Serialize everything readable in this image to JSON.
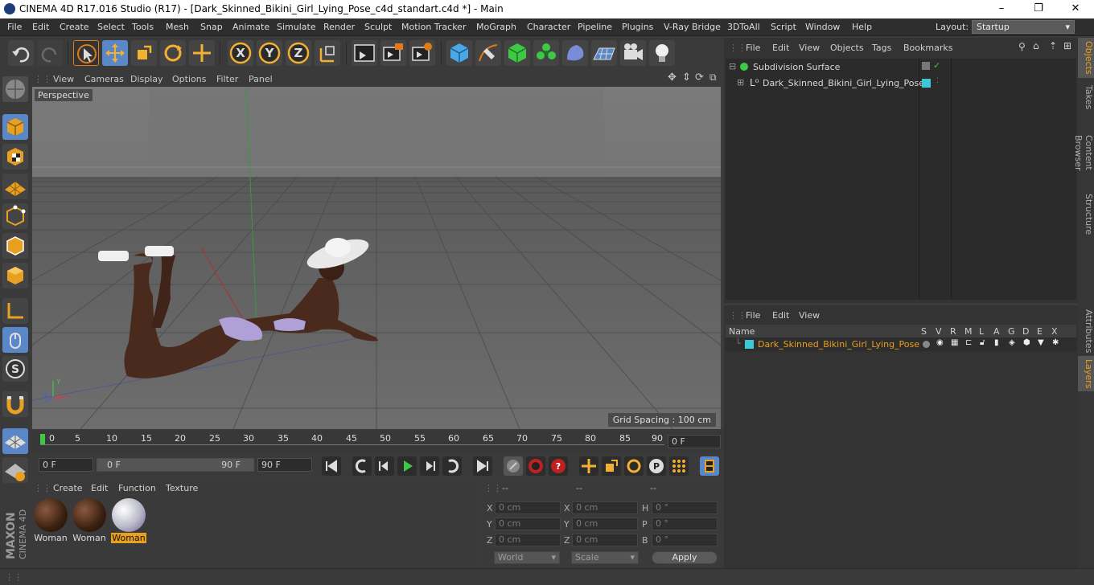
{
  "window": {
    "title": "CINEMA 4D R17.016 Studio (R17) - [Dark_Skinned_Bikini_Girl_Lying_Pose_c4d_standart.c4d *] - Main",
    "minimize": "–",
    "maximize": "❐",
    "close": "✕"
  },
  "menubar": {
    "items": [
      "File",
      "Edit",
      "Create",
      "Select",
      "Tools",
      "Mesh",
      "Snap",
      "Animate",
      "Simulate",
      "Render",
      "Sculpt",
      "Motion Tracker",
      "MoGraph",
      "Character",
      "Pipeline",
      "Plugins",
      "V-Ray Bridge",
      "3DToAll",
      "Script",
      "Window",
      "Help"
    ],
    "layout_label": "Layout:",
    "layout_value": "Startup"
  },
  "viewport": {
    "menu": [
      "View",
      "Cameras",
      "Display",
      "Options",
      "Filter",
      "Panel"
    ],
    "camera_label": "Perspective",
    "grid_spacing": "Grid Spacing : 100 cm",
    "axis_labels": {
      "x": "X",
      "y": "Y",
      "z": "Z"
    }
  },
  "timeline": {
    "ticks": [
      "0",
      "5",
      "10",
      "15",
      "20",
      "25",
      "30",
      "35",
      "40",
      "45",
      "50",
      "55",
      "60",
      "65",
      "70",
      "75",
      "80",
      "85",
      "90"
    ],
    "current_frame": "0 F"
  },
  "transport": {
    "start": "0 F",
    "slider_start": "0 F",
    "slider_end": "90 F",
    "end": "90 F"
  },
  "material_manager": {
    "menu": [
      "Create",
      "Edit",
      "Function",
      "Texture"
    ],
    "materials": [
      {
        "name": "Woman",
        "selected": false
      },
      {
        "name": "Woman",
        "selected": false
      },
      {
        "name": "Woman",
        "selected": true
      }
    ]
  },
  "coordinates": {
    "headers": [
      "--",
      "--",
      "--"
    ],
    "rows": [
      {
        "a": "X",
        "av": "0 cm",
        "b": "X",
        "bv": "0 cm",
        "c": "H",
        "cv": "0 °"
      },
      {
        "a": "Y",
        "av": "0 cm",
        "b": "Y",
        "bv": "0 cm",
        "c": "P",
        "cv": "0 °"
      },
      {
        "a": "Z",
        "av": "0 cm",
        "b": "Z",
        "bv": "0 cm",
        "c": "B",
        "cv": "0 °"
      }
    ],
    "mode": "World",
    "scale": "Scale",
    "apply": "Apply"
  },
  "object_manager": {
    "menu": [
      "File",
      "Edit",
      "View",
      "Objects",
      "Tags",
      "Bookmarks"
    ],
    "objects": [
      {
        "name": "Subdivision Surface",
        "icon": "subdivision-icon"
      },
      {
        "name": "Dark_Skinned_Bikini_Girl_Lying_Pose",
        "icon": "null-object-icon"
      }
    ]
  },
  "layer_manager": {
    "menu": [
      "File",
      "Edit",
      "View"
    ],
    "columns": [
      "Name",
      "S",
      "V",
      "R",
      "M",
      "L",
      "A",
      "G",
      "D",
      "E",
      "X"
    ],
    "layers": [
      {
        "name": "Dark_Skinned_Bikini_Girl_Lying_Pose",
        "color": "#3cc8d8"
      }
    ]
  },
  "right_tabs": [
    "Objects",
    "Takes",
    "Content Browser",
    "Structure",
    "Attributes",
    "Layers"
  ],
  "branding": {
    "maxon": "MAXON",
    "product": "CINEMA 4D"
  },
  "colors": {
    "accent_orange": "#e8a020",
    "accent_blue": "#5a87c8",
    "layer_cyan": "#3cc8d8"
  }
}
